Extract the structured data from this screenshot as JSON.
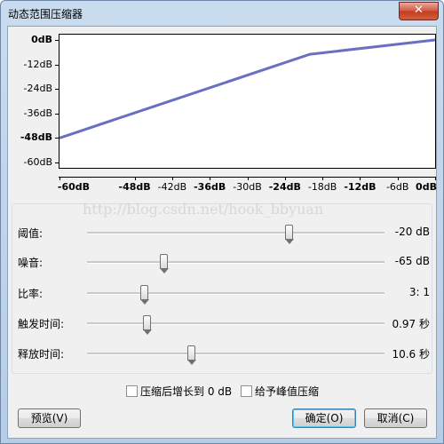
{
  "window": {
    "title": "动态范围压缩器",
    "close_glyph": "✕"
  },
  "chart_data": {
    "type": "line",
    "y_ticks": [
      "0dB",
      "-12dB",
      "-24dB",
      "-36dB",
      "-48dB",
      "-60dB"
    ],
    "y_tick_bold": [
      true,
      false,
      false,
      false,
      true,
      false
    ],
    "y_tick_values": [
      0,
      -12,
      -24,
      -36,
      -48,
      -60
    ],
    "x_ticks": [
      "-60dB",
      "-48dB",
      "-42dB",
      "-36dB",
      "-30dB",
      "-24dB",
      "-18dB",
      "-12dB",
      "-6dB",
      "0dB"
    ],
    "x_tick_bold": [
      true,
      true,
      false,
      true,
      false,
      true,
      false,
      true,
      false,
      true
    ],
    "x_tick_values": [
      -60,
      -48,
      -42,
      -36,
      -30,
      -24,
      -18,
      -12,
      -6,
      0
    ],
    "xlim": [
      -60,
      0
    ],
    "ylim": [
      -60,
      0
    ],
    "series": [
      {
        "x": [
          -60,
          -20,
          0
        ],
        "y": [
          -48,
          -7,
          0
        ]
      }
    ],
    "line_color": "#6b6fc4"
  },
  "controls": [
    {
      "label": "阈值:",
      "value": "-20 dB",
      "position": 0.677
    },
    {
      "label": "噪音:",
      "value": "-65 dB",
      "position": 0.258
    },
    {
      "label": "比率:",
      "value": "3: 1",
      "position": 0.19
    },
    {
      "label": "触发时间:",
      "value": "0.97 秒",
      "position": 0.2
    },
    {
      "label": "释放时间:",
      "value": "10.6 秒",
      "position": 0.35
    }
  ],
  "options": {
    "makeup_gain": "压缩后增长到 0 dB",
    "peak_compress": "给予峰值压缩"
  },
  "buttons": {
    "preview": "预览(V)",
    "ok": "确定(O)",
    "cancel": "取消(C)"
  },
  "watermark": "http://blog.csdn.net/hook_bbyuan"
}
